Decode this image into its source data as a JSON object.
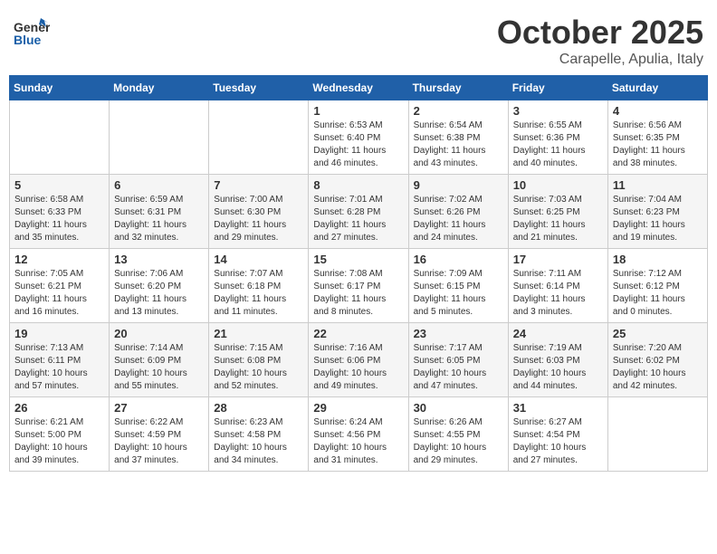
{
  "header": {
    "logo_line1": "General",
    "logo_line2": "Blue",
    "month": "October 2025",
    "location": "Carapelle, Apulia, Italy"
  },
  "weekdays": [
    "Sunday",
    "Monday",
    "Tuesday",
    "Wednesday",
    "Thursday",
    "Friday",
    "Saturday"
  ],
  "weeks": [
    [
      {
        "day": "",
        "info": ""
      },
      {
        "day": "",
        "info": ""
      },
      {
        "day": "",
        "info": ""
      },
      {
        "day": "1",
        "info": "Sunrise: 6:53 AM\nSunset: 6:40 PM\nDaylight: 11 hours\nand 46 minutes."
      },
      {
        "day": "2",
        "info": "Sunrise: 6:54 AM\nSunset: 6:38 PM\nDaylight: 11 hours\nand 43 minutes."
      },
      {
        "day": "3",
        "info": "Sunrise: 6:55 AM\nSunset: 6:36 PM\nDaylight: 11 hours\nand 40 minutes."
      },
      {
        "day": "4",
        "info": "Sunrise: 6:56 AM\nSunset: 6:35 PM\nDaylight: 11 hours\nand 38 minutes."
      }
    ],
    [
      {
        "day": "5",
        "info": "Sunrise: 6:58 AM\nSunset: 6:33 PM\nDaylight: 11 hours\nand 35 minutes."
      },
      {
        "day": "6",
        "info": "Sunrise: 6:59 AM\nSunset: 6:31 PM\nDaylight: 11 hours\nand 32 minutes."
      },
      {
        "day": "7",
        "info": "Sunrise: 7:00 AM\nSunset: 6:30 PM\nDaylight: 11 hours\nand 29 minutes."
      },
      {
        "day": "8",
        "info": "Sunrise: 7:01 AM\nSunset: 6:28 PM\nDaylight: 11 hours\nand 27 minutes."
      },
      {
        "day": "9",
        "info": "Sunrise: 7:02 AM\nSunset: 6:26 PM\nDaylight: 11 hours\nand 24 minutes."
      },
      {
        "day": "10",
        "info": "Sunrise: 7:03 AM\nSunset: 6:25 PM\nDaylight: 11 hours\nand 21 minutes."
      },
      {
        "day": "11",
        "info": "Sunrise: 7:04 AM\nSunset: 6:23 PM\nDaylight: 11 hours\nand 19 minutes."
      }
    ],
    [
      {
        "day": "12",
        "info": "Sunrise: 7:05 AM\nSunset: 6:21 PM\nDaylight: 11 hours\nand 16 minutes."
      },
      {
        "day": "13",
        "info": "Sunrise: 7:06 AM\nSunset: 6:20 PM\nDaylight: 11 hours\nand 13 minutes."
      },
      {
        "day": "14",
        "info": "Sunrise: 7:07 AM\nSunset: 6:18 PM\nDaylight: 11 hours\nand 11 minutes."
      },
      {
        "day": "15",
        "info": "Sunrise: 7:08 AM\nSunset: 6:17 PM\nDaylight: 11 hours\nand 8 minutes."
      },
      {
        "day": "16",
        "info": "Sunrise: 7:09 AM\nSunset: 6:15 PM\nDaylight: 11 hours\nand 5 minutes."
      },
      {
        "day": "17",
        "info": "Sunrise: 7:11 AM\nSunset: 6:14 PM\nDaylight: 11 hours\nand 3 minutes."
      },
      {
        "day": "18",
        "info": "Sunrise: 7:12 AM\nSunset: 6:12 PM\nDaylight: 11 hours\nand 0 minutes."
      }
    ],
    [
      {
        "day": "19",
        "info": "Sunrise: 7:13 AM\nSunset: 6:11 PM\nDaylight: 10 hours\nand 57 minutes."
      },
      {
        "day": "20",
        "info": "Sunrise: 7:14 AM\nSunset: 6:09 PM\nDaylight: 10 hours\nand 55 minutes."
      },
      {
        "day": "21",
        "info": "Sunrise: 7:15 AM\nSunset: 6:08 PM\nDaylight: 10 hours\nand 52 minutes."
      },
      {
        "day": "22",
        "info": "Sunrise: 7:16 AM\nSunset: 6:06 PM\nDaylight: 10 hours\nand 49 minutes."
      },
      {
        "day": "23",
        "info": "Sunrise: 7:17 AM\nSunset: 6:05 PM\nDaylight: 10 hours\nand 47 minutes."
      },
      {
        "day": "24",
        "info": "Sunrise: 7:19 AM\nSunset: 6:03 PM\nDaylight: 10 hours\nand 44 minutes."
      },
      {
        "day": "25",
        "info": "Sunrise: 7:20 AM\nSunset: 6:02 PM\nDaylight: 10 hours\nand 42 minutes."
      }
    ],
    [
      {
        "day": "26",
        "info": "Sunrise: 6:21 AM\nSunset: 5:00 PM\nDaylight: 10 hours\nand 39 minutes."
      },
      {
        "day": "27",
        "info": "Sunrise: 6:22 AM\nSunset: 4:59 PM\nDaylight: 10 hours\nand 37 minutes."
      },
      {
        "day": "28",
        "info": "Sunrise: 6:23 AM\nSunset: 4:58 PM\nDaylight: 10 hours\nand 34 minutes."
      },
      {
        "day": "29",
        "info": "Sunrise: 6:24 AM\nSunset: 4:56 PM\nDaylight: 10 hours\nand 31 minutes."
      },
      {
        "day": "30",
        "info": "Sunrise: 6:26 AM\nSunset: 4:55 PM\nDaylight: 10 hours\nand 29 minutes."
      },
      {
        "day": "31",
        "info": "Sunrise: 6:27 AM\nSunset: 4:54 PM\nDaylight: 10 hours\nand 27 minutes."
      },
      {
        "day": "",
        "info": ""
      }
    ]
  ]
}
